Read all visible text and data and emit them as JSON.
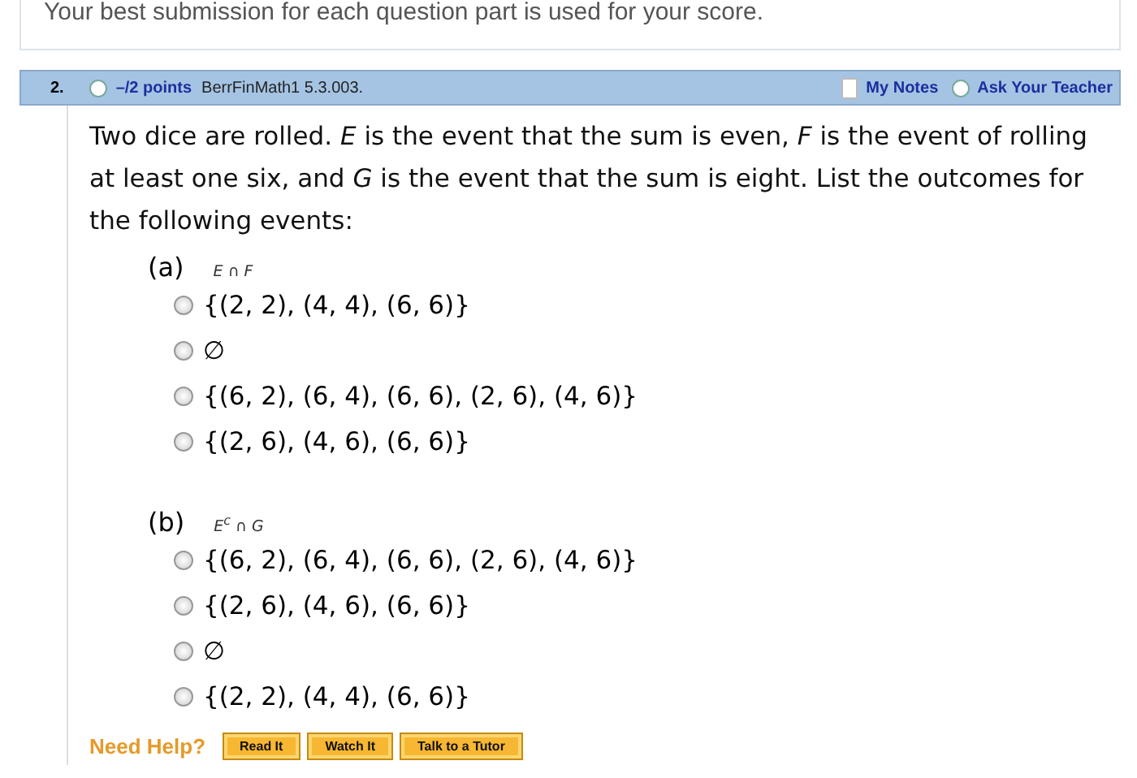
{
  "notice": "Your best submission for each question part is used for your score.",
  "header": {
    "number": "2.",
    "points": "–/2 points",
    "source": "BerrFinMath1 5.3.003.",
    "my_notes": "My Notes",
    "ask_teacher": "Ask Your Teacher"
  },
  "question": "Two dice are rolled. *E* is the event that the sum is even, *F* is the event of rolling at least one six, and *G* is the event that the sum is eight. List the outcomes for the following events:",
  "parts": [
    {
      "label": "(a)",
      "expression": "*E ∩ F*",
      "options": [
        {
          "text": "{(2, 2), (4, 4), (6, 6)}",
          "selected": false
        },
        {
          "text": "∅",
          "selected": false
        },
        {
          "text": "{(6, 2), (6, 4), (6, 6), (2, 6), (4, 6)}",
          "selected": false
        },
        {
          "text": "{(2, 6), (4, 6), (6, 6)}",
          "selected": false
        }
      ]
    },
    {
      "label": "(b)",
      "expression": "*E*$^{c}$ ∩ *G*",
      "options": [
        {
          "text": "{(6, 2), (6, 4), (6, 6), (2, 6), (4, 6)}",
          "selected": false
        },
        {
          "text": "{(2, 6), (4, 6), (6, 6)}",
          "selected": false
        },
        {
          "text": "∅",
          "selected": false
        },
        {
          "text": "{(2, 2), (4, 4), (6, 6)}",
          "selected": false
        }
      ]
    }
  ],
  "help": {
    "label": "Need Help?",
    "buttons": [
      "Read It",
      "Watch It",
      "Talk to a Tutor"
    ]
  }
}
